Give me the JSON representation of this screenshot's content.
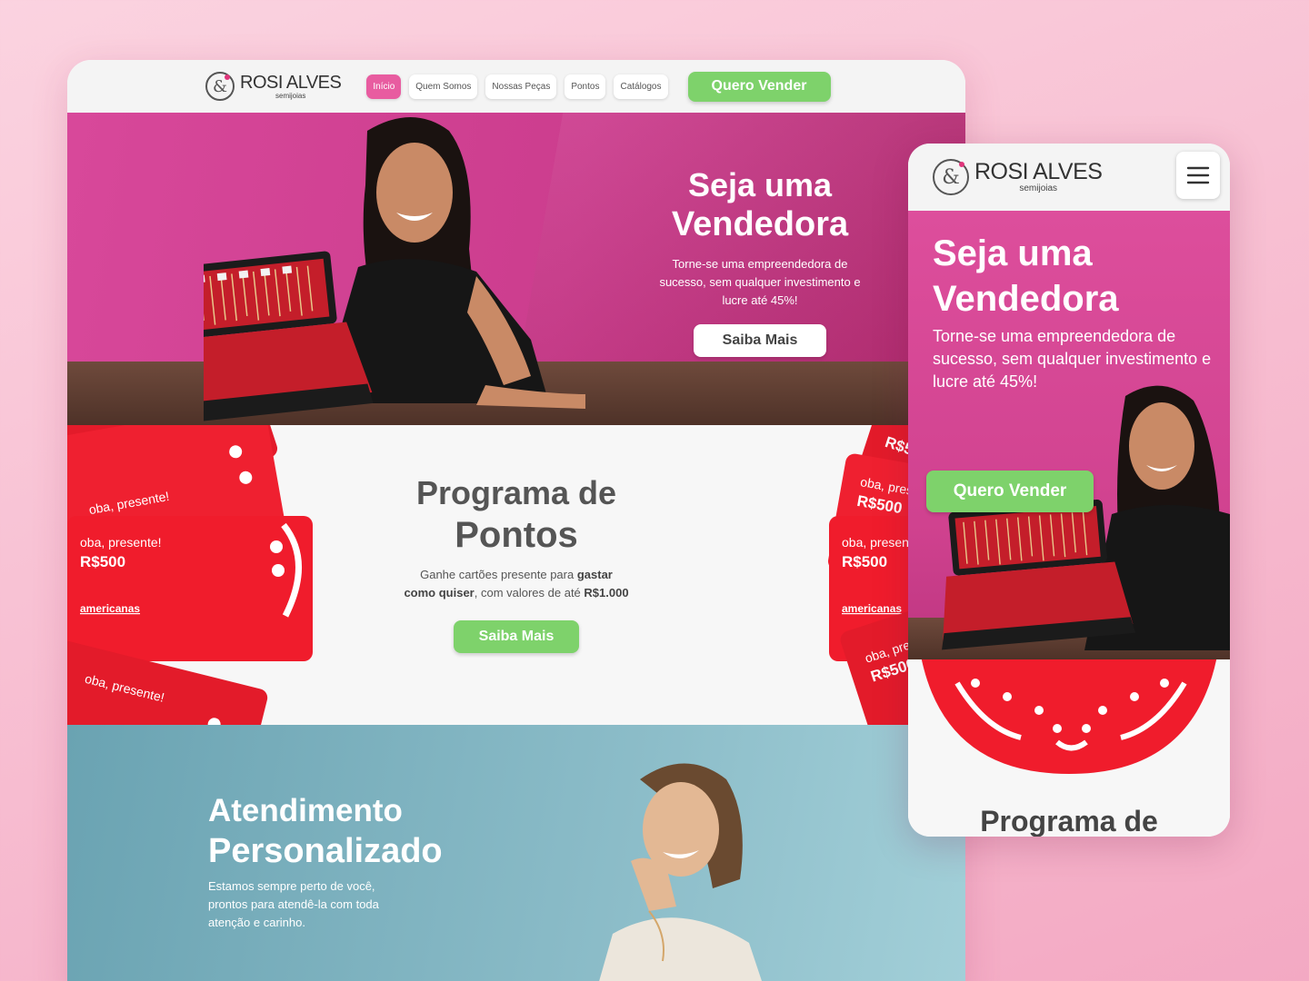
{
  "desktop": {
    "brand": {
      "name": "ROSI ALVES",
      "tagline": "semijoias"
    },
    "nav": {
      "items": [
        "Início",
        "Quem Somos",
        "Nossas Peças",
        "Pontos",
        "Catálogos"
      ],
      "active": "Início"
    },
    "cta_button": "Quero Vender",
    "hero": {
      "title_line1": "Seja uma",
      "title_line2": "Vendedora",
      "description": "Torne-se uma empreendedora de sucesso, sem qualquer investimento e lucre até 45%!",
      "button": "Saiba Mais"
    },
    "points": {
      "title_line1": "Programa de",
      "title_line2": "Pontos",
      "description_pre": "Ganhe cartões presente para ",
      "description_bold": "gastar como quiser",
      "description_mid": ", com valores de até ",
      "description_value": "R$1.000",
      "button": "Saiba Mais",
      "card_texts": [
        "oba, presente!",
        "R$500",
        "americanas"
      ]
    },
    "service": {
      "title_line1": "Atendimento",
      "title_line2": "Personalizado",
      "description": "Estamos sempre perto de você, prontos para atendê-la com toda atenção e carinho."
    }
  },
  "mobile": {
    "brand": {
      "name": "ROSI ALVES",
      "tagline": "semijoias"
    },
    "menu_icon": "hamburger-icon",
    "hero": {
      "title_line1": "Seja uma",
      "title_line2": "Vendedora",
      "description": "Torne-se uma empreendedora de sucesso, sem qualquer investimento e lucre até 45%!",
      "button": "Quero Vender"
    },
    "points": {
      "title_partial": "Programa de"
    }
  },
  "colors": {
    "pink": "#d8489a",
    "green": "#7ed26b",
    "red_card": "#f01c2c",
    "teal": "#8bbcc8",
    "background": "#f7bcd0"
  }
}
